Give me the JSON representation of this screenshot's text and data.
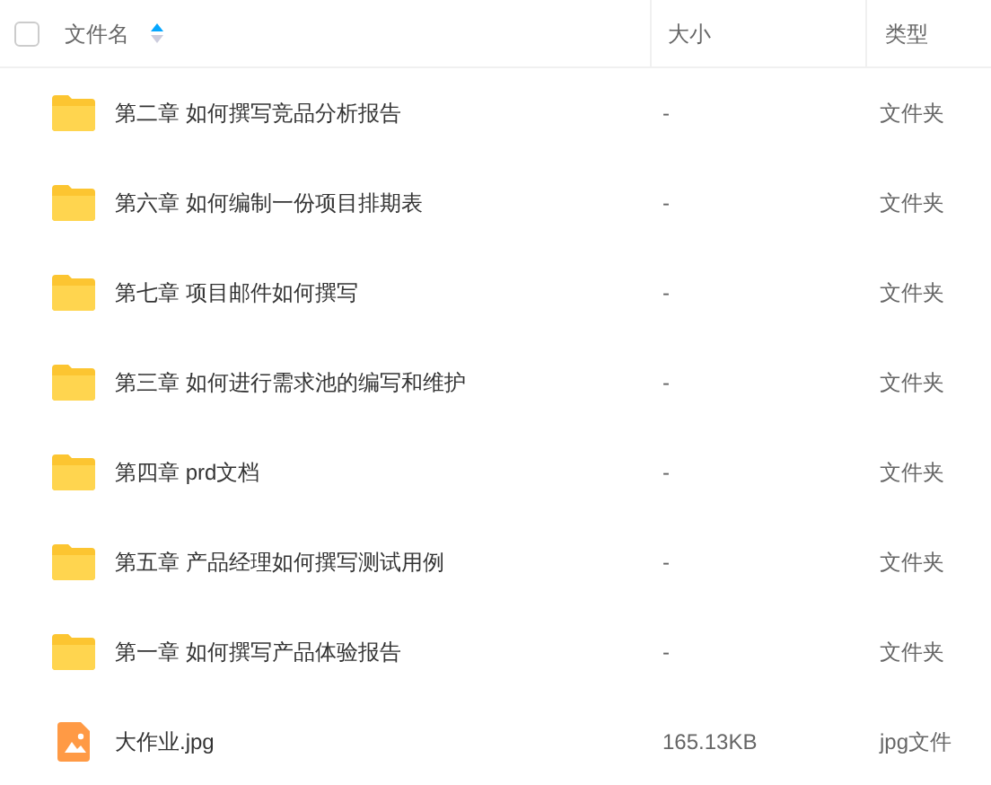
{
  "header": {
    "select_all": {
      "checked": false
    },
    "columns": [
      {
        "label": "文件名",
        "sorted_ascending": true
      },
      {
        "label": "大小"
      },
      {
        "label": "类型"
      }
    ]
  },
  "files": [
    {
      "kind": "folder",
      "name": "第二章 如何撰写竞品分析报告",
      "size": "-",
      "type": "文件夹"
    },
    {
      "kind": "folder",
      "name": "第六章 如何编制一份项目排期表",
      "size": "-",
      "type": "文件夹"
    },
    {
      "kind": "folder",
      "name": "第七章 项目邮件如何撰写",
      "size": "-",
      "type": "文件夹"
    },
    {
      "kind": "folder",
      "name": "第三章 如何进行需求池的编写和维护",
      "size": "-",
      "type": "文件夹"
    },
    {
      "kind": "folder",
      "name": "第四章 prd文档",
      "size": "-",
      "type": "文件夹"
    },
    {
      "kind": "folder",
      "name": "第五章 产品经理如何撰写测试用例",
      "size": "-",
      "type": "文件夹"
    },
    {
      "kind": "folder",
      "name": "第一章 如何撰写产品体验报告",
      "size": "-",
      "type": "文件夹"
    },
    {
      "kind": "image",
      "name": "大作业.jpg",
      "size": "165.13KB",
      "type": "jpg文件"
    }
  ]
}
